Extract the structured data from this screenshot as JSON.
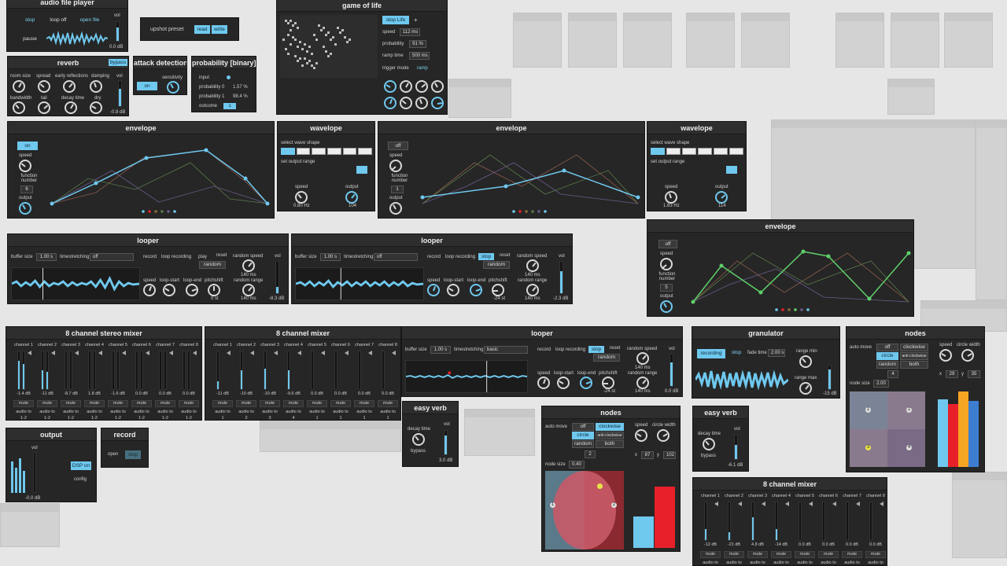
{
  "audio_file_player": {
    "title": "audio file player",
    "stop": "stop",
    "loop_off": "loop off",
    "open_file": "open file",
    "pause": "pause",
    "vol": "vol",
    "db": "0.0 dB"
  },
  "upshot_preset": {
    "label": "upshot preset",
    "read": "read",
    "write": "write"
  },
  "game_of_life": {
    "title": "game of life",
    "stop_life": "stop Life",
    "plus": "+",
    "speed_label": "speed",
    "speed": "112 ms",
    "probability_label": "probability",
    "probability": "91 %",
    "ramp_time_label": "ramp time",
    "ramp_time": "500 ms",
    "trigger_mode_label": "trigger mode",
    "trigger_mode": "ramp"
  },
  "reverb": {
    "title": "reverb",
    "bypass": "bypass",
    "room_size": "room size",
    "spread": "spread",
    "early_reflections": "early reflections",
    "damping": "damping",
    "vol": "vol",
    "bandwidth": "bandwidth",
    "tail": "tail",
    "decay_time": "decay time",
    "dry": "dry",
    "db": "-0.8 dB"
  },
  "attack_detection": {
    "title": "attack detection",
    "on": "on",
    "sensitivity": "sensitivity"
  },
  "probability": {
    "title": "probability [binary]",
    "input": "input",
    "p0_label": "probability 0",
    "p0": "1.57 %",
    "p1_label": "probability 1",
    "p1": "98.4 %",
    "outcome_label": "outcome",
    "outcome": "1"
  },
  "envelope1": {
    "title": "envelope",
    "toggle": "on",
    "speed": "speed",
    "function_number": "function number",
    "fn": "6",
    "output": "output"
  },
  "wavelope1": {
    "title": "wavelope",
    "select_wave_shape": "select wave shape",
    "set_output_range": "set output range",
    "speed": "speed",
    "speed_val": "0.80 Hz",
    "output": "output",
    "output_val": "104"
  },
  "envelope2": {
    "title": "envelope",
    "toggle": "off",
    "speed": "speed",
    "function_number": "function number",
    "fn": "1",
    "output": "output"
  },
  "wavelope2": {
    "title": "wavelope",
    "select_wave_shape": "select wave shape",
    "set_output_range": "set output range",
    "speed": "speed",
    "speed_val": "1.63 Hz",
    "output": "output",
    "output_val": "114"
  },
  "envelope3": {
    "title": "envelope",
    "toggle": "off",
    "speed": "speed",
    "function_number": "function number",
    "fn": "5",
    "output": "output"
  },
  "looper1": {
    "title": "looper",
    "buffer_size": "buffer size",
    "buffer_val": "1.00 s",
    "timestretching": "timestretching",
    "ts_val": "off",
    "record": "record",
    "loop_recording": "loop recording",
    "play": "play",
    "reset": "reset",
    "random": "random",
    "random_speed": "random speed",
    "rs_val": "140 ms",
    "vol": "vol",
    "speed": "speed",
    "loop_start": "loop-start",
    "loop_end": "loop-end",
    "pitchshift": "pitchshift",
    "ps_val": "0 st",
    "random_range": "random range",
    "rr_val": "140 ms",
    "db": "-8.3 dB"
  },
  "looper2": {
    "title": "looper",
    "buffer_size": "buffer size",
    "buffer_val": "1.00 s",
    "timestretching": "timestretching",
    "ts_val": "off",
    "record": "record",
    "loop_recording": "loop recording",
    "stop": "stop",
    "reset": "reset",
    "random": "random",
    "random_speed": "random speed",
    "rs_val": "140 ms",
    "vol": "vol",
    "speed": "speed",
    "loop_start": "loop-start",
    "loop_end": "loop-end",
    "pitchshift": "pitchshift",
    "ps_val": "-24 st",
    "random_range": "random range",
    "rr_val": "140 ms",
    "db": "-2.3 dB"
  },
  "looper3": {
    "title": "looper",
    "buffer_size": "buffer size",
    "buffer_val": "1.00 s",
    "timestretching": "timestretching",
    "ts_val": "basic",
    "record": "record",
    "loop_recording": "loop recording",
    "stop": "stop",
    "reset": "reset",
    "random": "random",
    "random_speed": "random speed",
    "rs_val": "140 ms",
    "vol": "vol",
    "speed": "speed",
    "loop_start": "loop-start",
    "loop_end": "loop-end",
    "pitchshift": "pitchshift",
    "ps_val": "-24 st",
    "random_range": "random range",
    "rr_val": "140 ms",
    "db": "0.0 dB"
  },
  "mixer_stereo": {
    "title": "8 channel stereo mixer",
    "channels": [
      {
        "name": "channel 1",
        "db": "-1.4 dB",
        "mute": "mute",
        "audio_to": "audio to",
        "route": "1-2",
        "level": 0.75
      },
      {
        "name": "channel 2",
        "db": "-11 dB",
        "mute": "mute",
        "audio_to": "audio to",
        "route": "1-2",
        "level": 0.5
      },
      {
        "name": "channel 3",
        "db": "-8.7 dB",
        "mute": "mute",
        "audio_to": "audio to",
        "route": "1-2",
        "level": 0
      },
      {
        "name": "channel 4",
        "db": "1.8 dB",
        "mute": "mute",
        "audio_to": "audio to",
        "route": "1-2",
        "level": 0
      },
      {
        "name": "channel 5",
        "db": "-1.6 dB",
        "mute": "mute",
        "audio_to": "audio to",
        "route": "1-2",
        "level": 0
      },
      {
        "name": "channel 6",
        "db": "0.0 dB",
        "mute": "mute",
        "audio_to": "audio to",
        "route": "1-2",
        "level": 0
      },
      {
        "name": "channel 7",
        "db": "0.0 dB",
        "mute": "mute",
        "audio_to": "audio to",
        "route": "1-2",
        "level": 0
      },
      {
        "name": "channel 8",
        "db": "0.0 dB",
        "mute": "mute",
        "audio_to": "audio to",
        "route": "1-2",
        "level": 0
      }
    ]
  },
  "mixer_mono": {
    "title": "8 channel mixer",
    "channels": [
      {
        "name": "channel 1",
        "db": "-11 dB",
        "mute": "mute",
        "audio_to": "audio to",
        "route": "1",
        "level": 0.2
      },
      {
        "name": "channel 2",
        "db": "-10 dB",
        "mute": "mute",
        "audio_to": "audio to",
        "route": "2",
        "level": 0.5
      },
      {
        "name": "channel 3",
        "db": "-10 dB",
        "mute": "mute",
        "audio_to": "audio to",
        "route": "3",
        "level": 0.55
      },
      {
        "name": "channel 4",
        "db": "-9.6 dB",
        "mute": "mute",
        "audio_to": "audio to",
        "route": "4",
        "level": 0.5
      },
      {
        "name": "channel 5",
        "db": "0.0 dB",
        "mute": "mute",
        "audio_to": "audio to",
        "route": "1",
        "level": 0
      },
      {
        "name": "channel 6",
        "db": "0.0 dB",
        "mute": "mute",
        "audio_to": "audio to",
        "route": "1",
        "level": 0
      },
      {
        "name": "channel 7",
        "db": "0.0 dB",
        "mute": "mute",
        "audio_to": "audio to",
        "route": "1",
        "level": 0
      },
      {
        "name": "channel 8",
        "db": "0.0 dB",
        "mute": "mute",
        "audio_to": "audio to",
        "route": "1",
        "level": 0
      }
    ]
  },
  "mixer_mono2": {
    "title": "8 channel mixer",
    "channels": [
      {
        "name": "channel 1",
        "db": "-12 dB",
        "mute": "mute",
        "audio_to": "audio to",
        "level": 0.3
      },
      {
        "name": "channel 2",
        "db": "-21 dB",
        "mute": "mute",
        "audio_to": "audio to",
        "level": 0.2
      },
      {
        "name": "channel 3",
        "db": "4.8 dB",
        "mute": "mute",
        "audio_to": "audio to",
        "level": 0.6
      },
      {
        "name": "channel 4",
        "db": "-14 dB",
        "mute": "mute",
        "audio_to": "audio to",
        "level": 0.3
      },
      {
        "name": "channel 5",
        "db": "0.0 dB",
        "mute": "mute",
        "audio_to": "audio to",
        "level": 0
      },
      {
        "name": "channel 6",
        "db": "0.0 dB",
        "mute": "mute",
        "audio_to": "audio to",
        "level": 0
      },
      {
        "name": "channel 7",
        "db": "0.0 dB",
        "mute": "mute",
        "audio_to": "audio to",
        "level": 0
      },
      {
        "name": "channel 8",
        "db": "0.0 dB",
        "mute": "mute",
        "audio_to": "audio to",
        "level": 0
      }
    ]
  },
  "granulator": {
    "title": "granulator",
    "recording": "recording",
    "stop": "stop",
    "fade_time": "fade time",
    "fade_val": "2.00 s",
    "range_min": "range min",
    "range_max": "range max",
    "db": "-15 dB"
  },
  "nodes1": {
    "title": "nodes",
    "auto_move": "auto move",
    "off": "off",
    "clockwise": "clockwise",
    "circle": "circle",
    "anti_clockwise": "anti-clockwise",
    "random": "random",
    "both": "both",
    "count": "2",
    "speed": "speed",
    "circle_width": "circle width",
    "x_label": "x",
    "x": "87",
    "y_label": "y",
    "y": "102",
    "node_size": "node size",
    "node_size_val": "0.40",
    "n1": "1",
    "n2": "2"
  },
  "nodes2": {
    "title": "nodes",
    "auto_move": "auto move",
    "off": "off",
    "clockwise": "clockwise",
    "circle": "circle",
    "anti_clockwise": "anti-clockwise",
    "random": "random",
    "both": "both",
    "count": "4",
    "speed": "speed",
    "circle_width": "circle width",
    "x_label": "x",
    "x": "29",
    "y_label": "y",
    "y": "35",
    "node_size": "node size",
    "node_size_val": "2.00",
    "n1": "1",
    "n2": "2",
    "n3": "3",
    "n4": "4"
  },
  "easy_verb1": {
    "title": "easy verb",
    "decay_time": "decay time",
    "vol": "vol",
    "bypass": "bypass",
    "db": "3.0 dB"
  },
  "easy_verb2": {
    "title": "easy verb",
    "decay_time": "decay time",
    "vol": "vol",
    "bypass": "bypass",
    "db": "-6.1 dB"
  },
  "output": {
    "title": "output",
    "vol": "vol",
    "dsp_on": "DSP on",
    "config": "config",
    "db": "-0.0 dB"
  },
  "record": {
    "title": "record",
    "open": "open",
    "stop": "stop"
  },
  "colors": {
    "accent": "#6fc8ee",
    "panel": "#262626",
    "red": "#e8202a",
    "orange": "#f5a623",
    "blue": "#3d7dd1"
  }
}
